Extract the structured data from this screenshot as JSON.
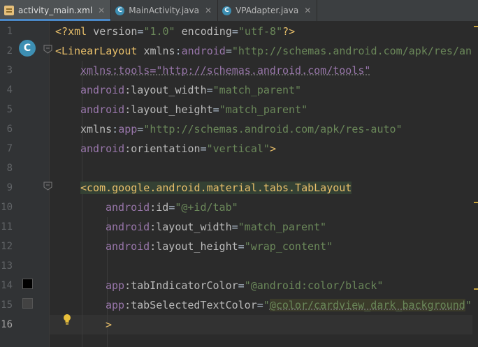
{
  "tabs": [
    {
      "label": "activity_main.xml",
      "icon": "xml-file-icon",
      "active": true
    },
    {
      "label": "MainActivity.java",
      "icon": "class-icon",
      "active": false
    },
    {
      "label": "VPAdapter.java",
      "icon": "class-icon",
      "active": false
    }
  ],
  "gutter": {
    "line_numbers": [
      "1",
      "2",
      "3",
      "4",
      "5",
      "6",
      "7",
      "8",
      "9",
      "10",
      "11",
      "12",
      "13",
      "14",
      "15",
      "16"
    ],
    "class_marker_letter": "C",
    "swatch_colors": [
      "#000000",
      "#424242"
    ]
  },
  "code": {
    "l1": {
      "a": "<?",
      "b": "xml ",
      "c": "version",
      "d": "=",
      "e": "\"1.0\"",
      "f": " encoding",
      "g": "=",
      "h": "\"utf-8\"",
      "i": "?>"
    },
    "l2": {
      "a": "<LinearLayout ",
      "b": "xmlns",
      "c": ":",
      "d": "android",
      "e": "=",
      "f": "\"http://schemas.android.com/apk/res/and"
    },
    "l3": {
      "a": "xmlns:tools=\"http://schemas.android.com/tools\""
    },
    "l4": {
      "a": "android",
      "b": ":layout_width",
      "c": "=",
      "d": "\"match_parent\""
    },
    "l5": {
      "a": "android",
      "b": ":layout_height",
      "c": "=",
      "d": "\"match_parent\""
    },
    "l6": {
      "a": "xmlns",
      "b": ":",
      "c": "app",
      "d": "=",
      "e": "\"http://schemas.android.com/apk/res-auto\""
    },
    "l7": {
      "a": "android",
      "b": ":orientation",
      "c": "=",
      "d": "\"vertical\"",
      "e": ">"
    },
    "l9": {
      "a": "<com.google.android.material.tabs.TabLayout"
    },
    "l10": {
      "a": "android",
      "b": ":id",
      "c": "=",
      "d": "\"@+id/tab\""
    },
    "l11": {
      "a": "android",
      "b": ":layout_width",
      "c": "=",
      "d": "\"match_parent\""
    },
    "l12": {
      "a": "android",
      "b": ":layout_height",
      "c": "=",
      "d": "\"wrap_content\""
    },
    "l14": {
      "a": "app",
      "b": ":tabIndicatorColor",
      "c": "=",
      "d": "\"@android:color/black\""
    },
    "l15": {
      "a": "app",
      "b": ":tabSelectedTextColor",
      "c": "=",
      "d": "\"",
      "e": "@color/cardview_dark_background",
      "f": "\""
    },
    "l16": {
      "a": ">"
    }
  },
  "colors": {
    "background": "#2b2b2b",
    "gutter": "#313335",
    "tag": "#e8bf6a",
    "namespace": "#9876aa",
    "string": "#6a8759",
    "attribute": "#bababa",
    "accent": "#4a88c7"
  }
}
